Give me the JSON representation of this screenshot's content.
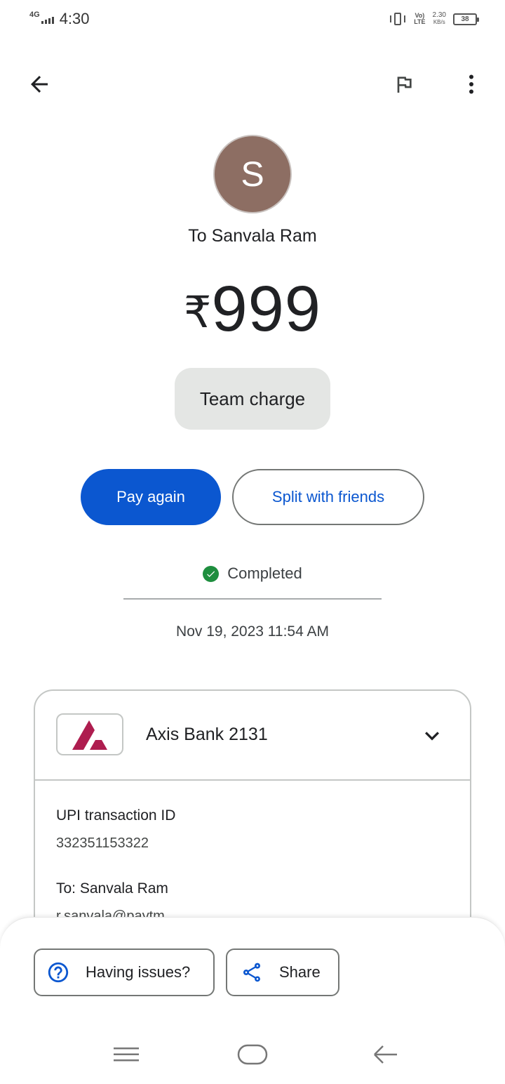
{
  "status_bar": {
    "network": "4G",
    "time": "4:30",
    "volte_top": "Vo)",
    "volte_bottom": "LTE",
    "speed_value": "2.30",
    "speed_unit": "KB/s",
    "battery": "38"
  },
  "app_bar": {
    "back_icon": "arrow-left-icon",
    "flag_icon": "flag-icon",
    "more_icon": "more-vert-icon"
  },
  "transaction": {
    "avatar_letter": "S",
    "avatar_color": "#8d6e63",
    "recipient_line": "To Sanvala Ram",
    "currency": "₹",
    "amount": "999",
    "note": "Team charge",
    "pay_again_label": "Pay again",
    "split_label": "Split with friends",
    "status": "Completed",
    "status_color": "#1e8e3e",
    "datetime": "Nov 19, 2023 11:54 AM"
  },
  "details_card": {
    "bank_name": "Axis Bank 2131",
    "bank_brand_color": "#ae1d4f",
    "upi_label": "UPI transaction ID",
    "upi_value": "332351153322",
    "to_label": "To: Sanvala Ram",
    "to_value": "r.sanvala@paytm"
  },
  "bottom_sheet": {
    "issues_label": "Having issues?",
    "share_label": "Share"
  },
  "accent_color": "#0b57d0"
}
